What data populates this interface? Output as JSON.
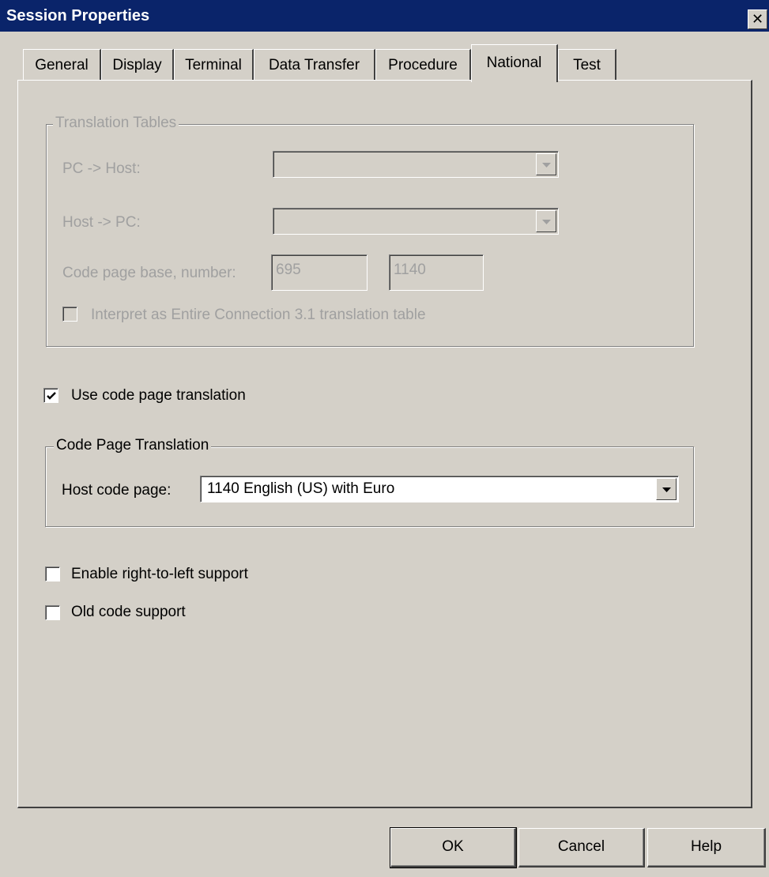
{
  "window": {
    "title": "Session Properties"
  },
  "tabs": [
    {
      "label": "General"
    },
    {
      "label": "Display"
    },
    {
      "label": "Terminal"
    },
    {
      "label": "Data Transfer"
    },
    {
      "label": "Procedure"
    },
    {
      "label": "National",
      "active": true
    },
    {
      "label": "Test"
    }
  ],
  "translation_tables": {
    "legend": "Translation Tables",
    "pc_to_host_label": "PC -> Host:",
    "pc_to_host_value": "",
    "host_to_pc_label": "Host -> PC:",
    "host_to_pc_value": "",
    "code_page_label": "Code page base, number:",
    "code_page_base": "695",
    "code_page_number": "1140",
    "interpret_label": "Interpret as Entire Connection 3.1 translation table",
    "interpret_checked": false,
    "disabled": true
  },
  "use_code_page": {
    "label": "Use code page translation",
    "checked": true
  },
  "code_page_translation": {
    "legend": "Code Page Translation",
    "host_code_page_label": "Host code page:",
    "host_code_page_value": "1140 English (US) with Euro"
  },
  "rtl_support": {
    "label": "Enable right-to-left support",
    "checked": false
  },
  "old_code": {
    "label": "Old code support",
    "checked": false
  },
  "buttons": {
    "ok": "OK",
    "cancel": "Cancel",
    "help": "Help"
  },
  "colors": {
    "titlebar": "#0a246a",
    "face": "#d4d0c8",
    "disabled_text": "#a0a0a0"
  }
}
